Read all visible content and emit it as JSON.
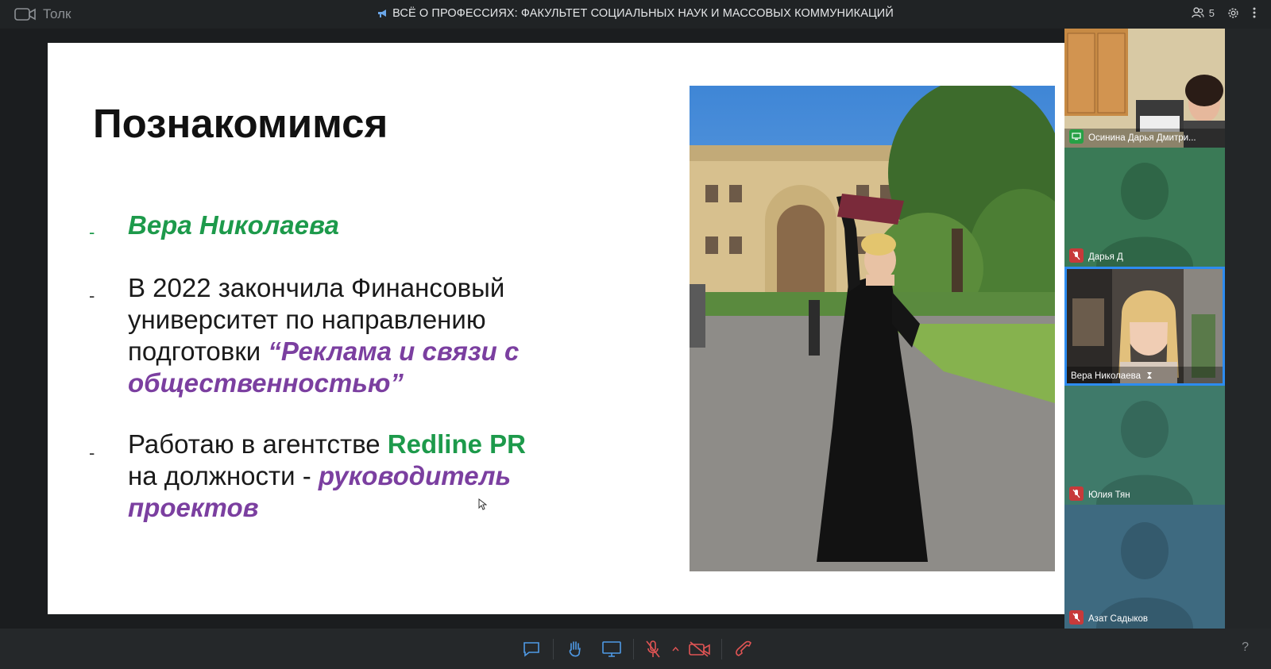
{
  "app": {
    "name": "Толк"
  },
  "meeting": {
    "title": "ВСЁ О ПРОФЕССИЯХ: ФАКУЛЬТЕТ СОЦИАЛЬНЫХ НАУК И МАССОВЫХ КОММУНИКАЦИЙ",
    "participants_count": "5"
  },
  "slide": {
    "title": "Познакомимся",
    "bullets": [
      {
        "marker": "-",
        "name": "Вера Николаева"
      },
      {
        "marker": "-",
        "line1": "В 2022 закончила Финансовый",
        "line2": "университет по направлению",
        "line3_plain": "подготовки ",
        "line3_accent": "“Реклама и связи с",
        "line4_accent": "общественностью”"
      },
      {
        "marker": "-",
        "line1_plain": "Работаю в агентстве ",
        "line1_accent": "Redline PR",
        "line2_plain": "на должности - ",
        "line2_accent": "руководитель",
        "line3_accent": "проектов"
      }
    ]
  },
  "participants": [
    {
      "name": "Осинина Дарья Дмитри...",
      "status": "screen-share"
    },
    {
      "name": "Дарья Д",
      "status": "muted"
    },
    {
      "name": "Вера Николаева",
      "status": "speaking"
    },
    {
      "name": "Юлия Тян",
      "status": "muted"
    },
    {
      "name": "Азат Садыков",
      "status": "muted"
    }
  ],
  "toolbar": {
    "help": "?"
  },
  "colors": {
    "accent_green": "#1d9a4b",
    "accent_purple": "#7b3fa0",
    "muted_red": "#c73a3a",
    "active_blue": "#2d8cf0"
  }
}
